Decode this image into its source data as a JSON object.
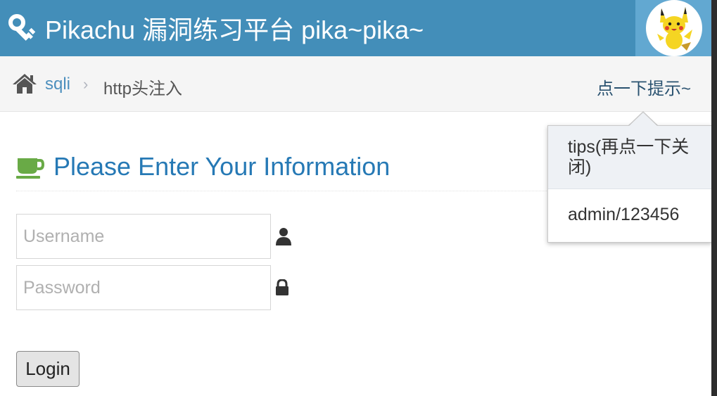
{
  "navbar": {
    "brand_title": "Pikachu 漏洞练习平台 pika~pika~",
    "brand_icon": "key-icon",
    "avatar_icon": "pikachu-avatar"
  },
  "breadcrumb": {
    "home_icon": "home-icon",
    "link_label": "sqli",
    "separator": "›",
    "current_label": "http头注入",
    "tip_trigger_label": "点一下提示~"
  },
  "main": {
    "title_icon": "coffee-cup-icon",
    "title": "Please Enter Your Information",
    "username_placeholder": "Username",
    "password_placeholder": "Password",
    "username_value": "",
    "password_value": "",
    "user_icon": "user-icon",
    "lock_icon": "lock-icon",
    "login_label": "Login"
  },
  "popover": {
    "title": "tips(再点一下关闭)",
    "content": "admin/123456"
  },
  "colors": {
    "navbar_bg": "#438eb9",
    "avatar_bg": "#62a8d1",
    "title_color": "#2679b5",
    "link_color": "#4c8fbd",
    "cup_color": "#69aa46"
  }
}
